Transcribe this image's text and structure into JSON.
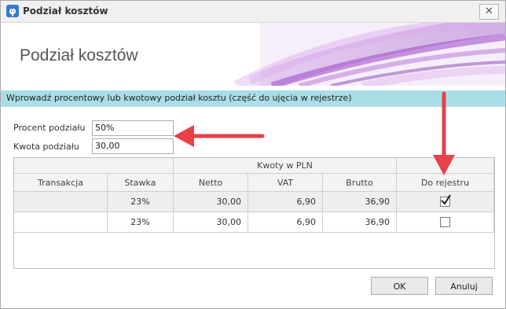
{
  "window": {
    "title": "Podział kosztów"
  },
  "banner": {
    "heading": "Podział kosztów"
  },
  "info": {
    "text": "Wprowadź procentowy lub kwotowy podział kosztu (część do ujęcia w rejestrze)"
  },
  "form": {
    "percent_label": "Procent podziału",
    "percent_value": "50%",
    "amount_label": "Kwota podziału",
    "amount_value": "30,00"
  },
  "grid": {
    "group_header": "Kwoty w PLN",
    "columns": [
      "Transakcja",
      "Stawka",
      "Netto",
      "VAT",
      "Brutto",
      "Do rejestru"
    ],
    "rows": [
      {
        "transakcja": "",
        "stawka": "23%",
        "netto": "30,00",
        "vat": "6,90",
        "brutto": "36,90",
        "do_rejestru": true
      },
      {
        "transakcja": "",
        "stawka": "23%",
        "netto": "30,00",
        "vat": "6,90",
        "brutto": "36,90",
        "do_rejestru": false
      }
    ]
  },
  "buttons": {
    "ok": "OK",
    "cancel": "Anuluj"
  },
  "colors": {
    "info_bar": "#aadde6",
    "arrow": "#e8414a",
    "banner_swirl": "#a94fc8"
  }
}
